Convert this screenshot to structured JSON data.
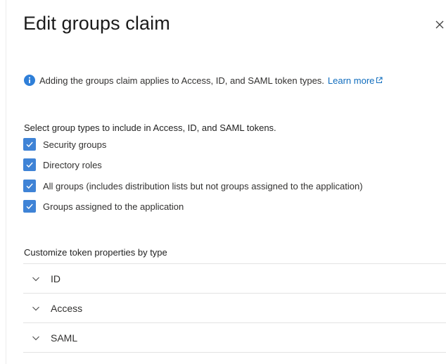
{
  "panel": {
    "title": "Edit groups claim",
    "close_icon": "close-icon"
  },
  "info": {
    "icon": "info-icon",
    "text": "Adding the groups claim applies to Access, ID, and SAML token types.",
    "learn_more_label": "Learn more",
    "link_icon": "external-link-icon"
  },
  "group_types": {
    "heading": "Select group types to include in Access, ID, and SAML tokens.",
    "options": [
      {
        "label": "Security groups",
        "checked": true
      },
      {
        "label": "Directory roles",
        "checked": true
      },
      {
        "label": "All groups (includes distribution lists but not groups assigned to the application)",
        "checked": true
      },
      {
        "label": "Groups assigned to the application",
        "checked": true
      }
    ]
  },
  "customize": {
    "heading": "Customize token properties by type",
    "sections": [
      {
        "label": "ID",
        "expanded": false
      },
      {
        "label": "Access",
        "expanded": false
      },
      {
        "label": "SAML",
        "expanded": false
      }
    ]
  },
  "colors": {
    "checkbox": "#3f83d6",
    "info_icon": "#2f7fd8",
    "link": "#0f6cbd"
  }
}
